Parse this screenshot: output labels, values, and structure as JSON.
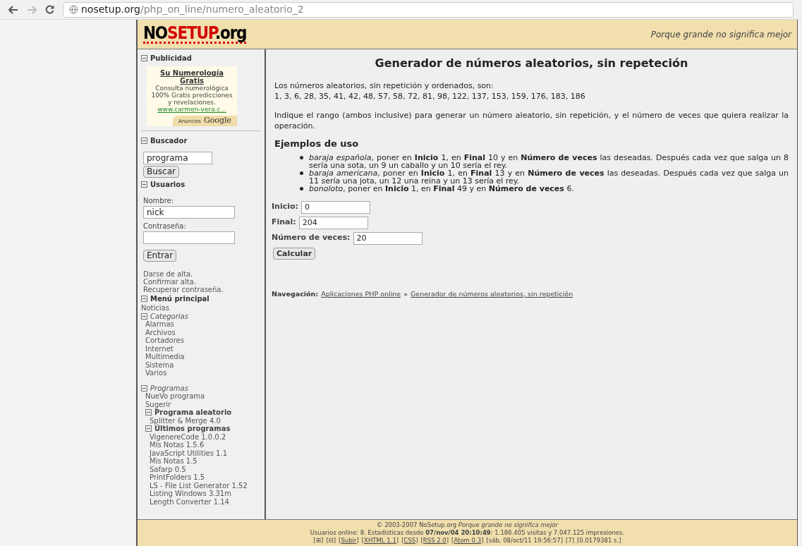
{
  "browser": {
    "url_host": "nosetup.org",
    "url_path": "/php_on_line/numero_aleatorio_2"
  },
  "header": {
    "logo": {
      "prefix": "NO",
      "highlight": "SETUP",
      "suffix": ".org"
    },
    "tagline": "Porque grande no significa mejor"
  },
  "sidebar": {
    "publicidad": {
      "title": "Publicidad",
      "expanded": true,
      "ad": {
        "title": "Su Numerología Gratis",
        "text": "Consulta numerológica 100% Gratis predicciones y revelaciones.",
        "link": "www.carmen-vera.c...",
        "badge_small": "Anuncios",
        "badge_large": "Google"
      }
    },
    "buscador": {
      "title": "Buscador",
      "expanded": true,
      "value": "programa",
      "button": "Buscar"
    },
    "usuarios": {
      "title": "Usuarios",
      "expanded": true,
      "fields": [
        {
          "label": "Nombre:",
          "value": "nick"
        },
        {
          "label": "Contraseña:"
        }
      ],
      "button": "Entrar",
      "links": [
        "Darse de alta.",
        "Confirmar alta.",
        "Recuperar contraseña."
      ]
    },
    "menu": {
      "title": "Menú principal",
      "expanded": true,
      "items": [
        {
          "kind": "link",
          "label": "Noticias"
        },
        {
          "kind": "category",
          "label": "Categorias",
          "expanded": true,
          "children": [
            {
              "kind": "link",
              "label": "Alarmas"
            },
            {
              "kind": "link",
              "label": "Archivos"
            },
            {
              "kind": "link",
              "label": "Cortadores"
            },
            {
              "kind": "link",
              "label": "Internet"
            },
            {
              "kind": "link",
              "label": "Multimedia"
            },
            {
              "kind": "link",
              "label": "Sistema"
            },
            {
              "kind": "link",
              "label": "Varios"
            }
          ]
        },
        {
          "kind": "category",
          "label": "Programas",
          "expanded": true,
          "children": [
            {
              "kind": "link",
              "label": "NueVo programa"
            },
            {
              "kind": "link",
              "label": "Sugerir"
            },
            {
              "kind": "group",
              "label": "Programa aleatorio",
              "expanded": true,
              "children": [
                {
                  "kind": "link",
                  "label": "Splitter & Merge 4.0"
                }
              ]
            },
            {
              "kind": "group",
              "label": "Últimos programas",
              "expanded": true,
              "children": [
                {
                  "kind": "link",
                  "label": "VigenereCode 1.0.0.2"
                },
                {
                  "kind": "link",
                  "label": "Mis Notas 1.5.6"
                },
                {
                  "kind": "link",
                  "label": "JavaScript Utilities 1.1"
                },
                {
                  "kind": "link",
                  "label": "Mis Notas 1.5"
                },
                {
                  "kind": "link",
                  "label": "Safarp 0.5"
                },
                {
                  "kind": "link",
                  "label": "PrintFolders 1.5"
                },
                {
                  "kind": "link",
                  "label": "LS - File List Generator 1.52"
                },
                {
                  "kind": "link",
                  "label": "Listing Windows 3.31m"
                },
                {
                  "kind": "link",
                  "label": "Length Converter 1.14"
                }
              ]
            }
          ]
        }
      ]
    }
  },
  "main": {
    "title": "Generador de números aleatorios, sin repeteción",
    "result_label": "Los números aleatorios, sin repetición y ordenados, son:",
    "result_numbers": "1, 3, 6, 28, 35, 41, 42, 48, 57, 58, 72, 81, 98, 122, 137, 153, 159, 176, 183, 186",
    "instructions": "Indique el rango (ambos inclusive) para generar un número aleatorio, sin repetición, y el número de veces que quiera realizar la operación.",
    "examples_heading": "Ejemplos de uso",
    "examples": [
      "*baraja española*, poner en **Inicio** 1, en **Final** 10 y en **Número de veces** las deseadas. Después cada vez que salga un 8 sería una sota, un 9 un caballo y un 10 sería el rey.",
      "*baraja americana*, poner en **Inicio** 1, en **Final** 13 y en **Número de veces** las deseadas. Después cada vez que salga un 11 sería una jota, un 12 una reina y un 13 sería el rey.",
      "*bonoloto*, poner en **Inicio** 1, en **Final** 49 y en **Número de veces** 6."
    ],
    "fields": [
      {
        "label": "Inicio:",
        "value": "0"
      },
      {
        "label": "Final:",
        "value": "204"
      },
      {
        "label": "Número de veces:",
        "value": "20"
      }
    ],
    "button": "Calcular",
    "navigation": {
      "label": "Navegación:",
      "links": [
        "Aplicaciones PHP online",
        "Generador de números aleatorios, sin repetición"
      ],
      "separator": "»"
    }
  },
  "footer": {
    "line_1": "© 2003-2007 NoSetup.org *Porque grande no significa mejor*",
    "line_2": "Usuarios online: 8. Estadísticas desde **07/nov/04 20:10:49**: 1.186.405 visitas y 7.047.125 impresiones.",
    "line_3": [
      {
        "kind": "text",
        "text": "[⊞]"
      },
      {
        "kind": "text",
        "text": "[⊟]"
      },
      {
        "kind": "link",
        "before": "[",
        "text": "Subir",
        "after": "]"
      },
      {
        "kind": "link",
        "before": "[",
        "text": "XHTML 1.1",
        "after": "]"
      },
      {
        "kind": "link",
        "before": "[",
        "text": "CSS",
        "after": "]"
      },
      {
        "kind": "link",
        "before": "[",
        "text": "RSS 2.0",
        "after": "]"
      },
      {
        "kind": "link",
        "before": "[",
        "text": "Atom 0.3",
        "after": "]"
      },
      {
        "kind": "text",
        "text": "[sáb, 08/oct/11 19:56:57]"
      },
      {
        "kind": "text",
        "text": "[7]"
      },
      {
        "kind": "text",
        "text": "[0.0179381 s.]"
      }
    ]
  }
}
